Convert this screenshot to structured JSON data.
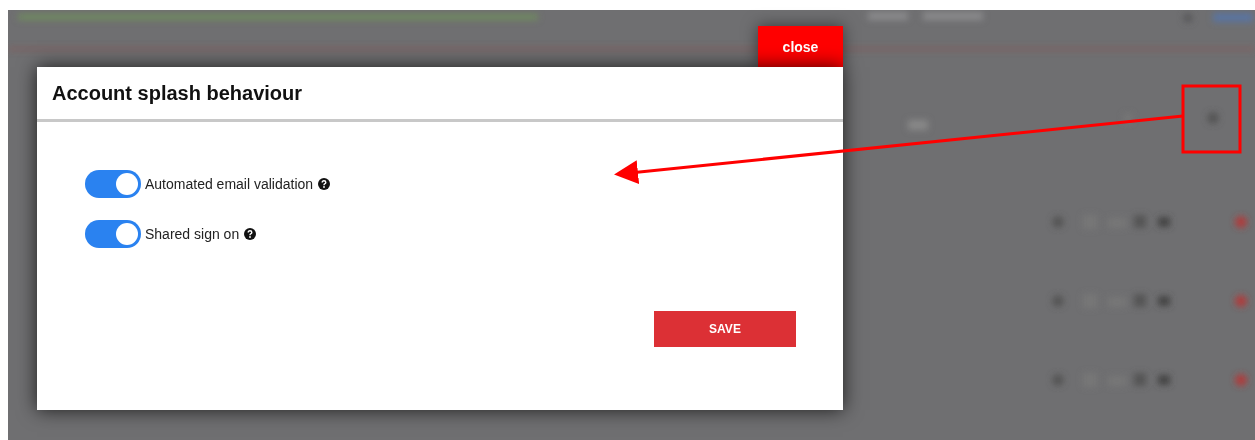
{
  "dialog": {
    "title": "Account splash behaviour",
    "close_label": "close",
    "toggles": [
      {
        "label": "Automated email validation",
        "on": true
      },
      {
        "label": "Shared sign on",
        "on": true
      }
    ],
    "save_label": "SAVE"
  }
}
